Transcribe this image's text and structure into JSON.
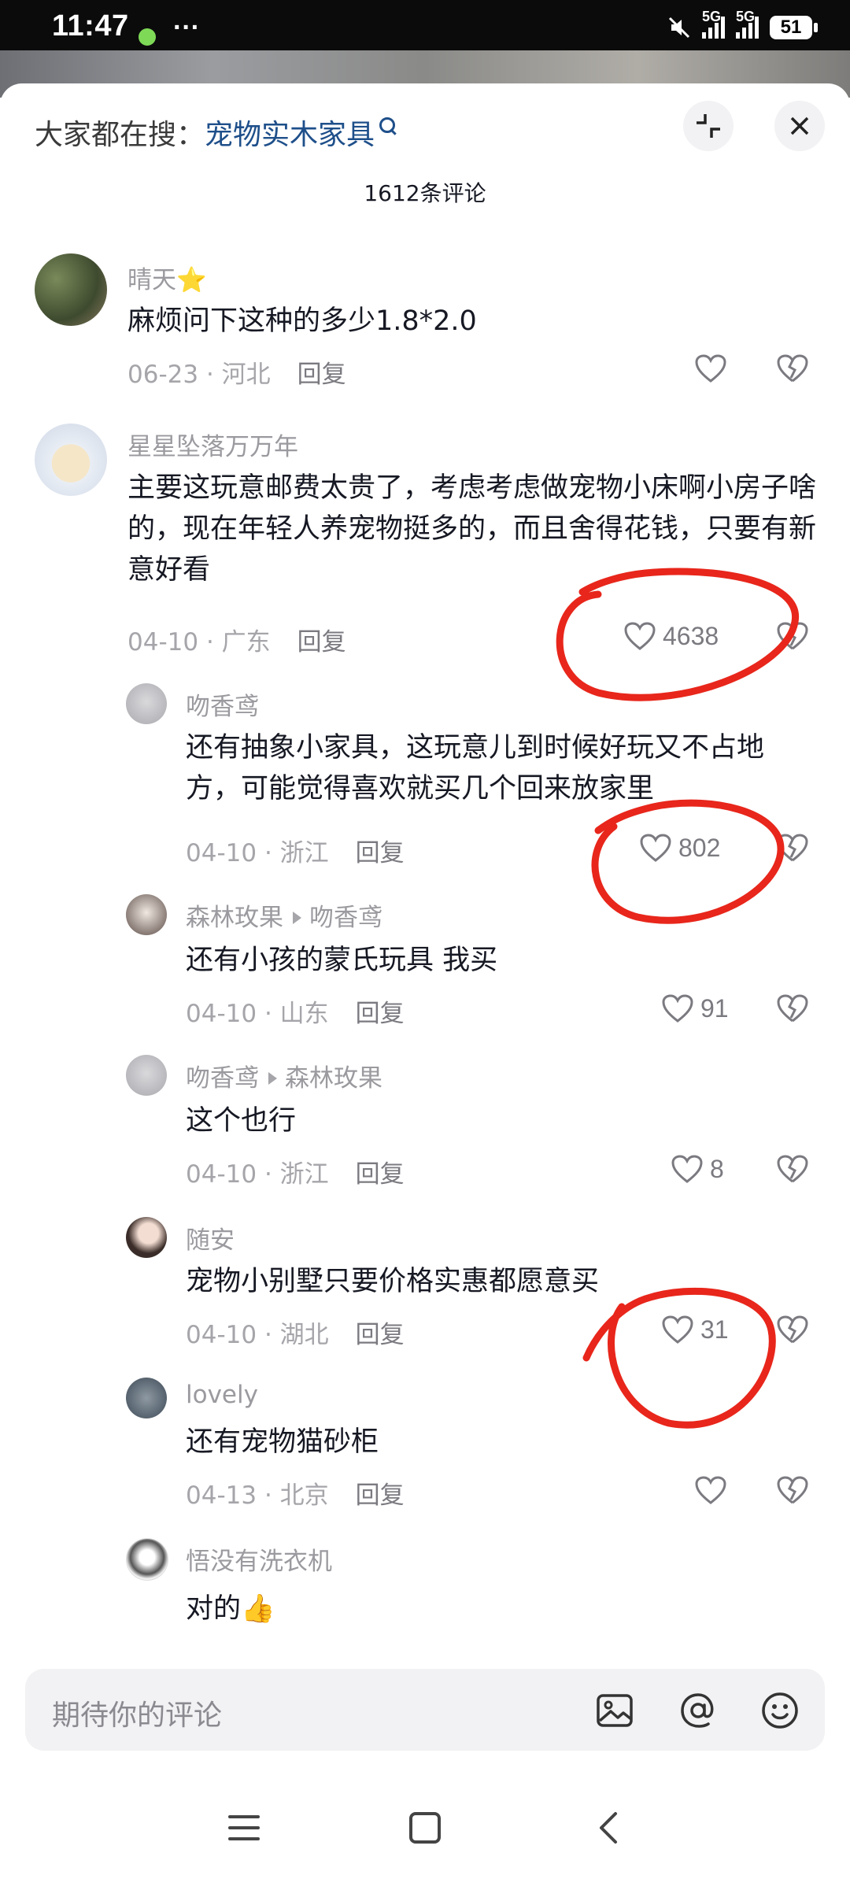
{
  "status": {
    "time": "11:47",
    "more": "···",
    "net1": "5G",
    "net2": "5G",
    "battery": "51"
  },
  "header": {
    "search_prefix": "大家都在搜：",
    "search_keyword": "宠物实木家具",
    "comment_count": "1612条评论"
  },
  "comments": [
    {
      "user": "晴天⭐",
      "text": "麻烦问下这种的多少1.8*2.0",
      "date": "06-23",
      "loc": "河北",
      "reply": "回复",
      "likes": ""
    },
    {
      "user": "星星坠落万万年",
      "text": "主要这玩意邮费太贵了，考虑考虑做宠物小床啊小房子啥的，现在年轻人养宠物挺多的，而且舍得花钱，只要有新意好看",
      "date": "04-10",
      "loc": "广东",
      "reply": "回复",
      "likes": "4638"
    },
    {
      "user": "吻香鸢",
      "text": "还有抽象小家具，这玩意儿到时候好玩又不占地方，可能觉得喜欢就买几个回来放家里",
      "date": "04-10",
      "loc": "浙江",
      "reply": "回复",
      "likes": "802"
    },
    {
      "user": "森林玫果",
      "reply_to": "吻香鸢",
      "text": "还有小孩的蒙氏玩具 我买",
      "date": "04-10",
      "loc": "山东",
      "reply": "回复",
      "likes": "91"
    },
    {
      "user": "吻香鸢",
      "reply_to": "森林玫果",
      "text": "这个也行",
      "date": "04-10",
      "loc": "浙江",
      "reply": "回复",
      "likes": "8"
    },
    {
      "user": "随安",
      "text": "宠物小别墅只要价格实惠都愿意买",
      "date": "04-10",
      "loc": "湖北",
      "reply": "回复",
      "likes": "31"
    },
    {
      "user": "lovely",
      "text": "还有宠物猫砂柜",
      "date": "04-13",
      "loc": "北京",
      "reply": "回复",
      "likes": ""
    },
    {
      "user": "悟没有洗衣机",
      "text": "对的👍",
      "date": "",
      "loc": "",
      "reply": "",
      "likes": ""
    }
  ],
  "input": {
    "placeholder": "期待你的评论"
  },
  "icons": [
    "minimize-icon",
    "close-icon",
    "heart-icon",
    "broken-heart-icon",
    "image-icon",
    "at-icon",
    "emoji-icon",
    "menu-icon",
    "home-icon",
    "back-icon"
  ],
  "colors": {
    "keyword": "#1e4f8a",
    "annotation": "#e8261b"
  }
}
